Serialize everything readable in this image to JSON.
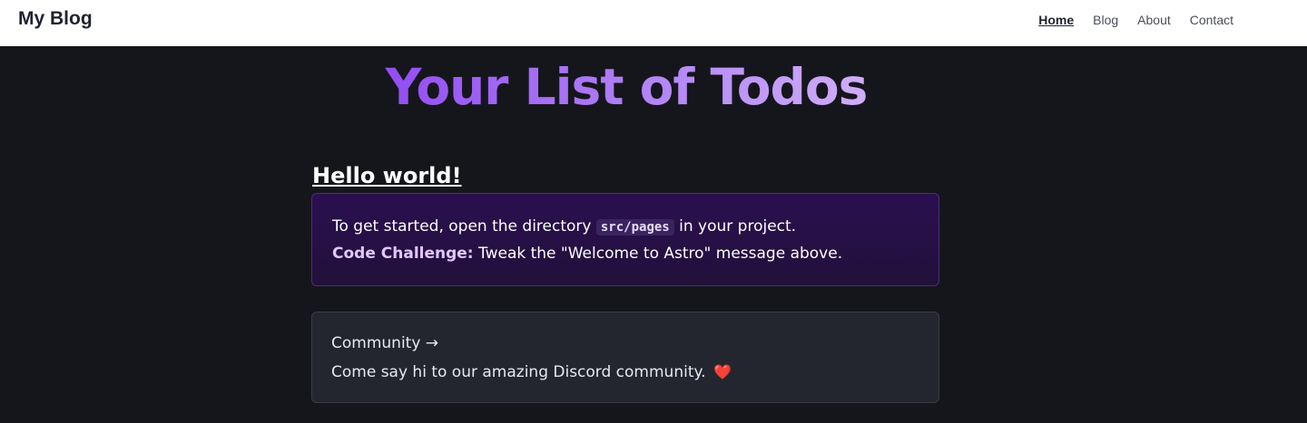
{
  "header": {
    "brand": "My Blog",
    "nav": [
      {
        "label": "Home",
        "active": true
      },
      {
        "label": "Blog",
        "active": false
      },
      {
        "label": "About",
        "active": false
      },
      {
        "label": "Contact",
        "active": false
      }
    ]
  },
  "main": {
    "title": "Your List of Todos",
    "greeting": "Hello world!",
    "instructions": {
      "line1_before": "To get started, open the directory",
      "code": "src/pages",
      "line1_after": "in your project.",
      "challenge_label": "Code Challenge:",
      "challenge_text": "Tweak the \"Welcome to Astro\" message above."
    },
    "community_card": {
      "title": "Community",
      "arrow": "→",
      "description": "Come say hi to our amazing Discord community.",
      "emoji_icon": "heart-icon",
      "emoji": "❤️"
    }
  },
  "colors": {
    "background": "#15161c",
    "header_bg": "#ffffff",
    "accent_purple": "#8a3ff2",
    "accent_light": "#e2c8fa"
  }
}
